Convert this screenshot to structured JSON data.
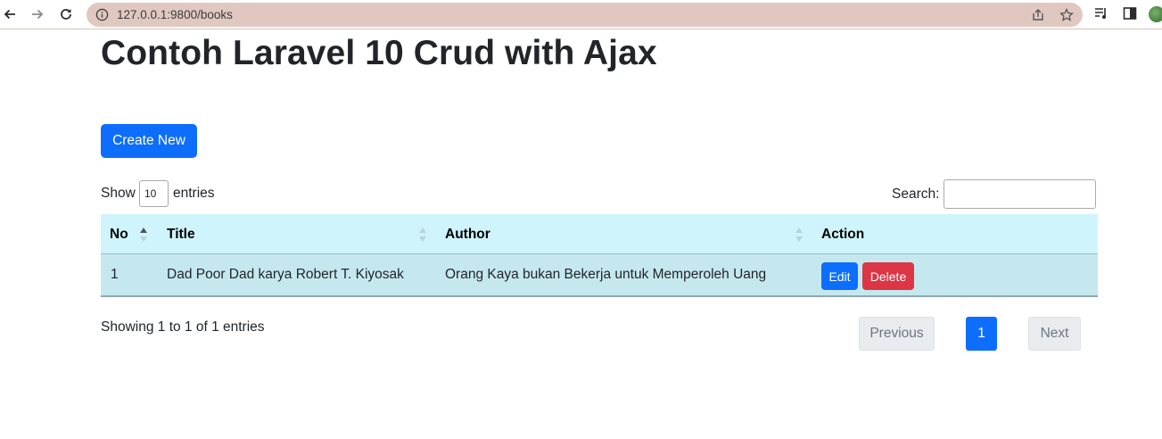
{
  "browser": {
    "url": "127.0.0.1:9800/books",
    "icons": [
      "back-arrow-icon",
      "forward-arrow-icon",
      "reload-icon",
      "info-icon",
      "share-icon",
      "bookmark-star-icon",
      "reading-list-icon",
      "side-panel-icon",
      "extension-avatar-icon"
    ]
  },
  "page": {
    "title": "Contoh Laravel 10 Crud with Ajax",
    "create_button": "Create New"
  },
  "controls": {
    "show_label": "Show",
    "page_length": "10",
    "entries_label": "entries",
    "search_label": "Search:",
    "search_value": ""
  },
  "table": {
    "headers": [
      "No",
      "Title",
      "Author",
      "Action"
    ],
    "rows": [
      {
        "no": "1",
        "title": "Dad Poor Dad karya Robert T. Kiyosak",
        "author": "Orang Kaya bukan Bekerja untuk Memperoleh Uang",
        "edit_label": "Edit",
        "delete_label": "Delete"
      }
    ]
  },
  "footer": {
    "info": "Showing 1 to 1 of 1 entries",
    "previous": "Previous",
    "current_page": "1",
    "next": "Next"
  },
  "colors": {
    "primary": "#0d6efd",
    "danger": "#dc3545",
    "table_header_bg": "#cff4fc",
    "table_row_bg": "#c5e8ef",
    "omnibox_bg": "#e0c8c1"
  }
}
